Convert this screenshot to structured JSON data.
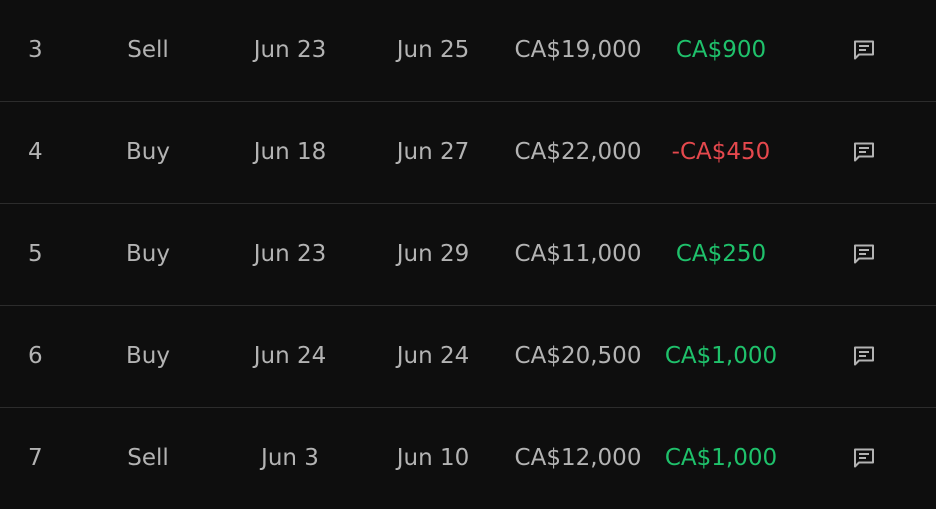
{
  "colors": {
    "background": "#0e0e0e",
    "text": "#b3b3b3",
    "divider": "#2c2c2c",
    "profit": "#1fc16b",
    "loss": "#e5484d"
  },
  "trades": [
    {
      "num": "3",
      "type": "Sell",
      "opened": "Jun 23",
      "closed": "Jun 25",
      "amount": "CA$19,000",
      "pnl": "CA$900",
      "pnl_sign": "pos",
      "note_icon": "comment-icon"
    },
    {
      "num": "4",
      "type": "Buy",
      "opened": "Jun 18",
      "closed": "Jun 27",
      "amount": "CA$22,000",
      "pnl": "-CA$450",
      "pnl_sign": "neg",
      "note_icon": "comment-icon"
    },
    {
      "num": "5",
      "type": "Buy",
      "opened": "Jun 23",
      "closed": "Jun 29",
      "amount": "CA$11,000",
      "pnl": "CA$250",
      "pnl_sign": "pos",
      "note_icon": "comment-icon"
    },
    {
      "num": "6",
      "type": "Buy",
      "opened": "Jun 24",
      "closed": "Jun 24",
      "amount": "CA$20,500",
      "pnl": "CA$1,000",
      "pnl_sign": "pos",
      "note_icon": "comment-icon"
    },
    {
      "num": "7",
      "type": "Sell",
      "opened": "Jun 3",
      "closed": "Jun 10",
      "amount": "CA$12,000",
      "pnl": "CA$1,000",
      "pnl_sign": "pos",
      "note_icon": "comment-icon"
    }
  ]
}
